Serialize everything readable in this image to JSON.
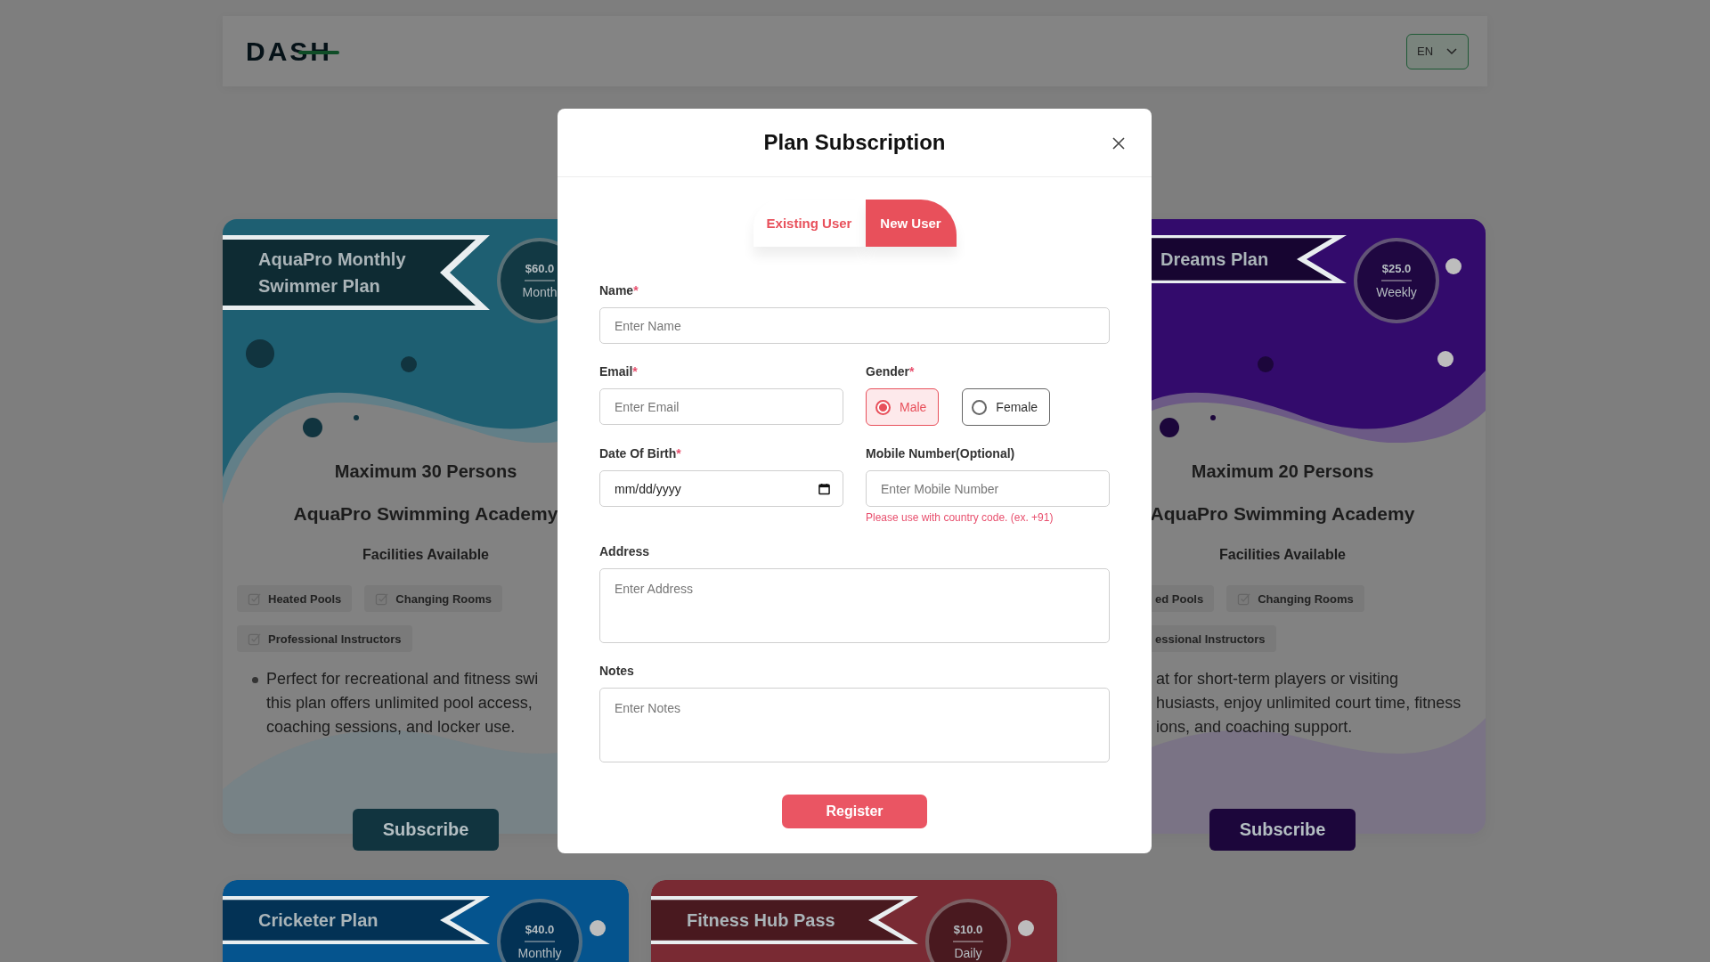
{
  "header": {
    "logo": "DASH",
    "language": "EN"
  },
  "top_cards": [
    {
      "color": "#1e5f72",
      "title": "AquaPro Monthly Swimmer Plan",
      "price": "$60.0",
      "period": "Month",
      "capacity": "Maximum 30 Persons",
      "academy": "AquaPro Swimming Academy",
      "facilities_title": "Facilities Available",
      "facilities": [
        {
          "label": "Heated Pools",
          "icon": true
        },
        {
          "label": "Changing Rooms",
          "icon": true
        },
        {
          "label": "Professional Instructors",
          "icon": true
        }
      ],
      "bullet": true,
      "description": "Perfect for recreational and fitness swi\nthis plan offers unlimited pool access,\ncoaching sessions, and locker use.",
      "button": "Subscribe"
    },
    {
      "color": "#330b6c",
      "title": "Dreams Plan",
      "price": "$25.0",
      "period": "Weekly",
      "capacity": "Maximum 20 Persons",
      "academy": "AquaPro Swimming Academy",
      "facilities_title": "Facilities Available",
      "facilities": [
        {
          "label": "ed Pools",
          "icon": false
        },
        {
          "label": "Changing Rooms",
          "icon": true
        },
        {
          "label": "essional Instructors",
          "icon": false
        }
      ],
      "bullet": false,
      "description": "at for short-term players or visiting\nhusiasts, enjoy unlimited court time, fitness\nions, and coaching support.",
      "button": "Subscribe"
    }
  ],
  "bottom_cards": [
    {
      "color": "#05548e",
      "title": "Cricketer Plan",
      "price": "$40.0",
      "period": "Monthly"
    },
    {
      "color": "#792a33",
      "title": "Fitness Hub Pass",
      "price": "$10.0",
      "period": "Daily"
    }
  ],
  "modal": {
    "title": "Plan Subscription",
    "tabs": [
      {
        "label": "Existing User",
        "selected": false
      },
      {
        "label": "New User",
        "selected": true
      }
    ],
    "rows": [
      [
        {
          "kind": "text",
          "label": "Name",
          "mark": "*",
          "placeholder": "Enter Name"
        }
      ],
      [
        {
          "kind": "text",
          "label": "Email",
          "mark": "*",
          "placeholder": "Enter Email"
        },
        {
          "kind": "radio",
          "label": "Gender",
          "mark": "*",
          "options": [
            {
              "label": "Male",
              "selected": true
            },
            {
              "label": "Female",
              "selected": false
            }
          ]
        }
      ],
      [
        {
          "kind": "date",
          "label": "Date Of Birth",
          "mark": "*",
          "placeholder": "mm/dd/yyyy"
        },
        {
          "kind": "text",
          "label": "Mobile Number(Optional)",
          "placeholder": "Enter Mobile Number",
          "hint": "Please use with country code. (ex. +91)"
        }
      ],
      [
        {
          "kind": "textarea",
          "label": "Address",
          "placeholder": "Enter Address"
        }
      ],
      [
        {
          "kind": "textarea",
          "label": "Notes",
          "placeholder": "Enter Notes"
        }
      ]
    ],
    "submit": "Register"
  }
}
